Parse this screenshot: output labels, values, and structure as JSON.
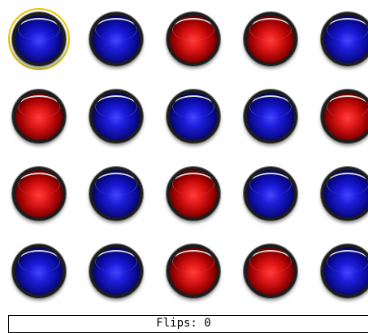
{
  "board": {
    "rows": [
      [
        "blue",
        "blue",
        "red",
        "red",
        "blue"
      ],
      [
        "red",
        "blue",
        "blue",
        "blue",
        "red"
      ],
      [
        "red",
        "blue",
        "red",
        "blue",
        "blue"
      ],
      [
        "blue",
        "blue",
        "red",
        "red",
        "blue"
      ]
    ],
    "selected": {
      "row": 0,
      "col": 0
    }
  },
  "colors": {
    "blue": "#1414d8",
    "red": "#e01010",
    "selection_ring": "#e3c400"
  },
  "status": {
    "label": "Flips: 0"
  }
}
